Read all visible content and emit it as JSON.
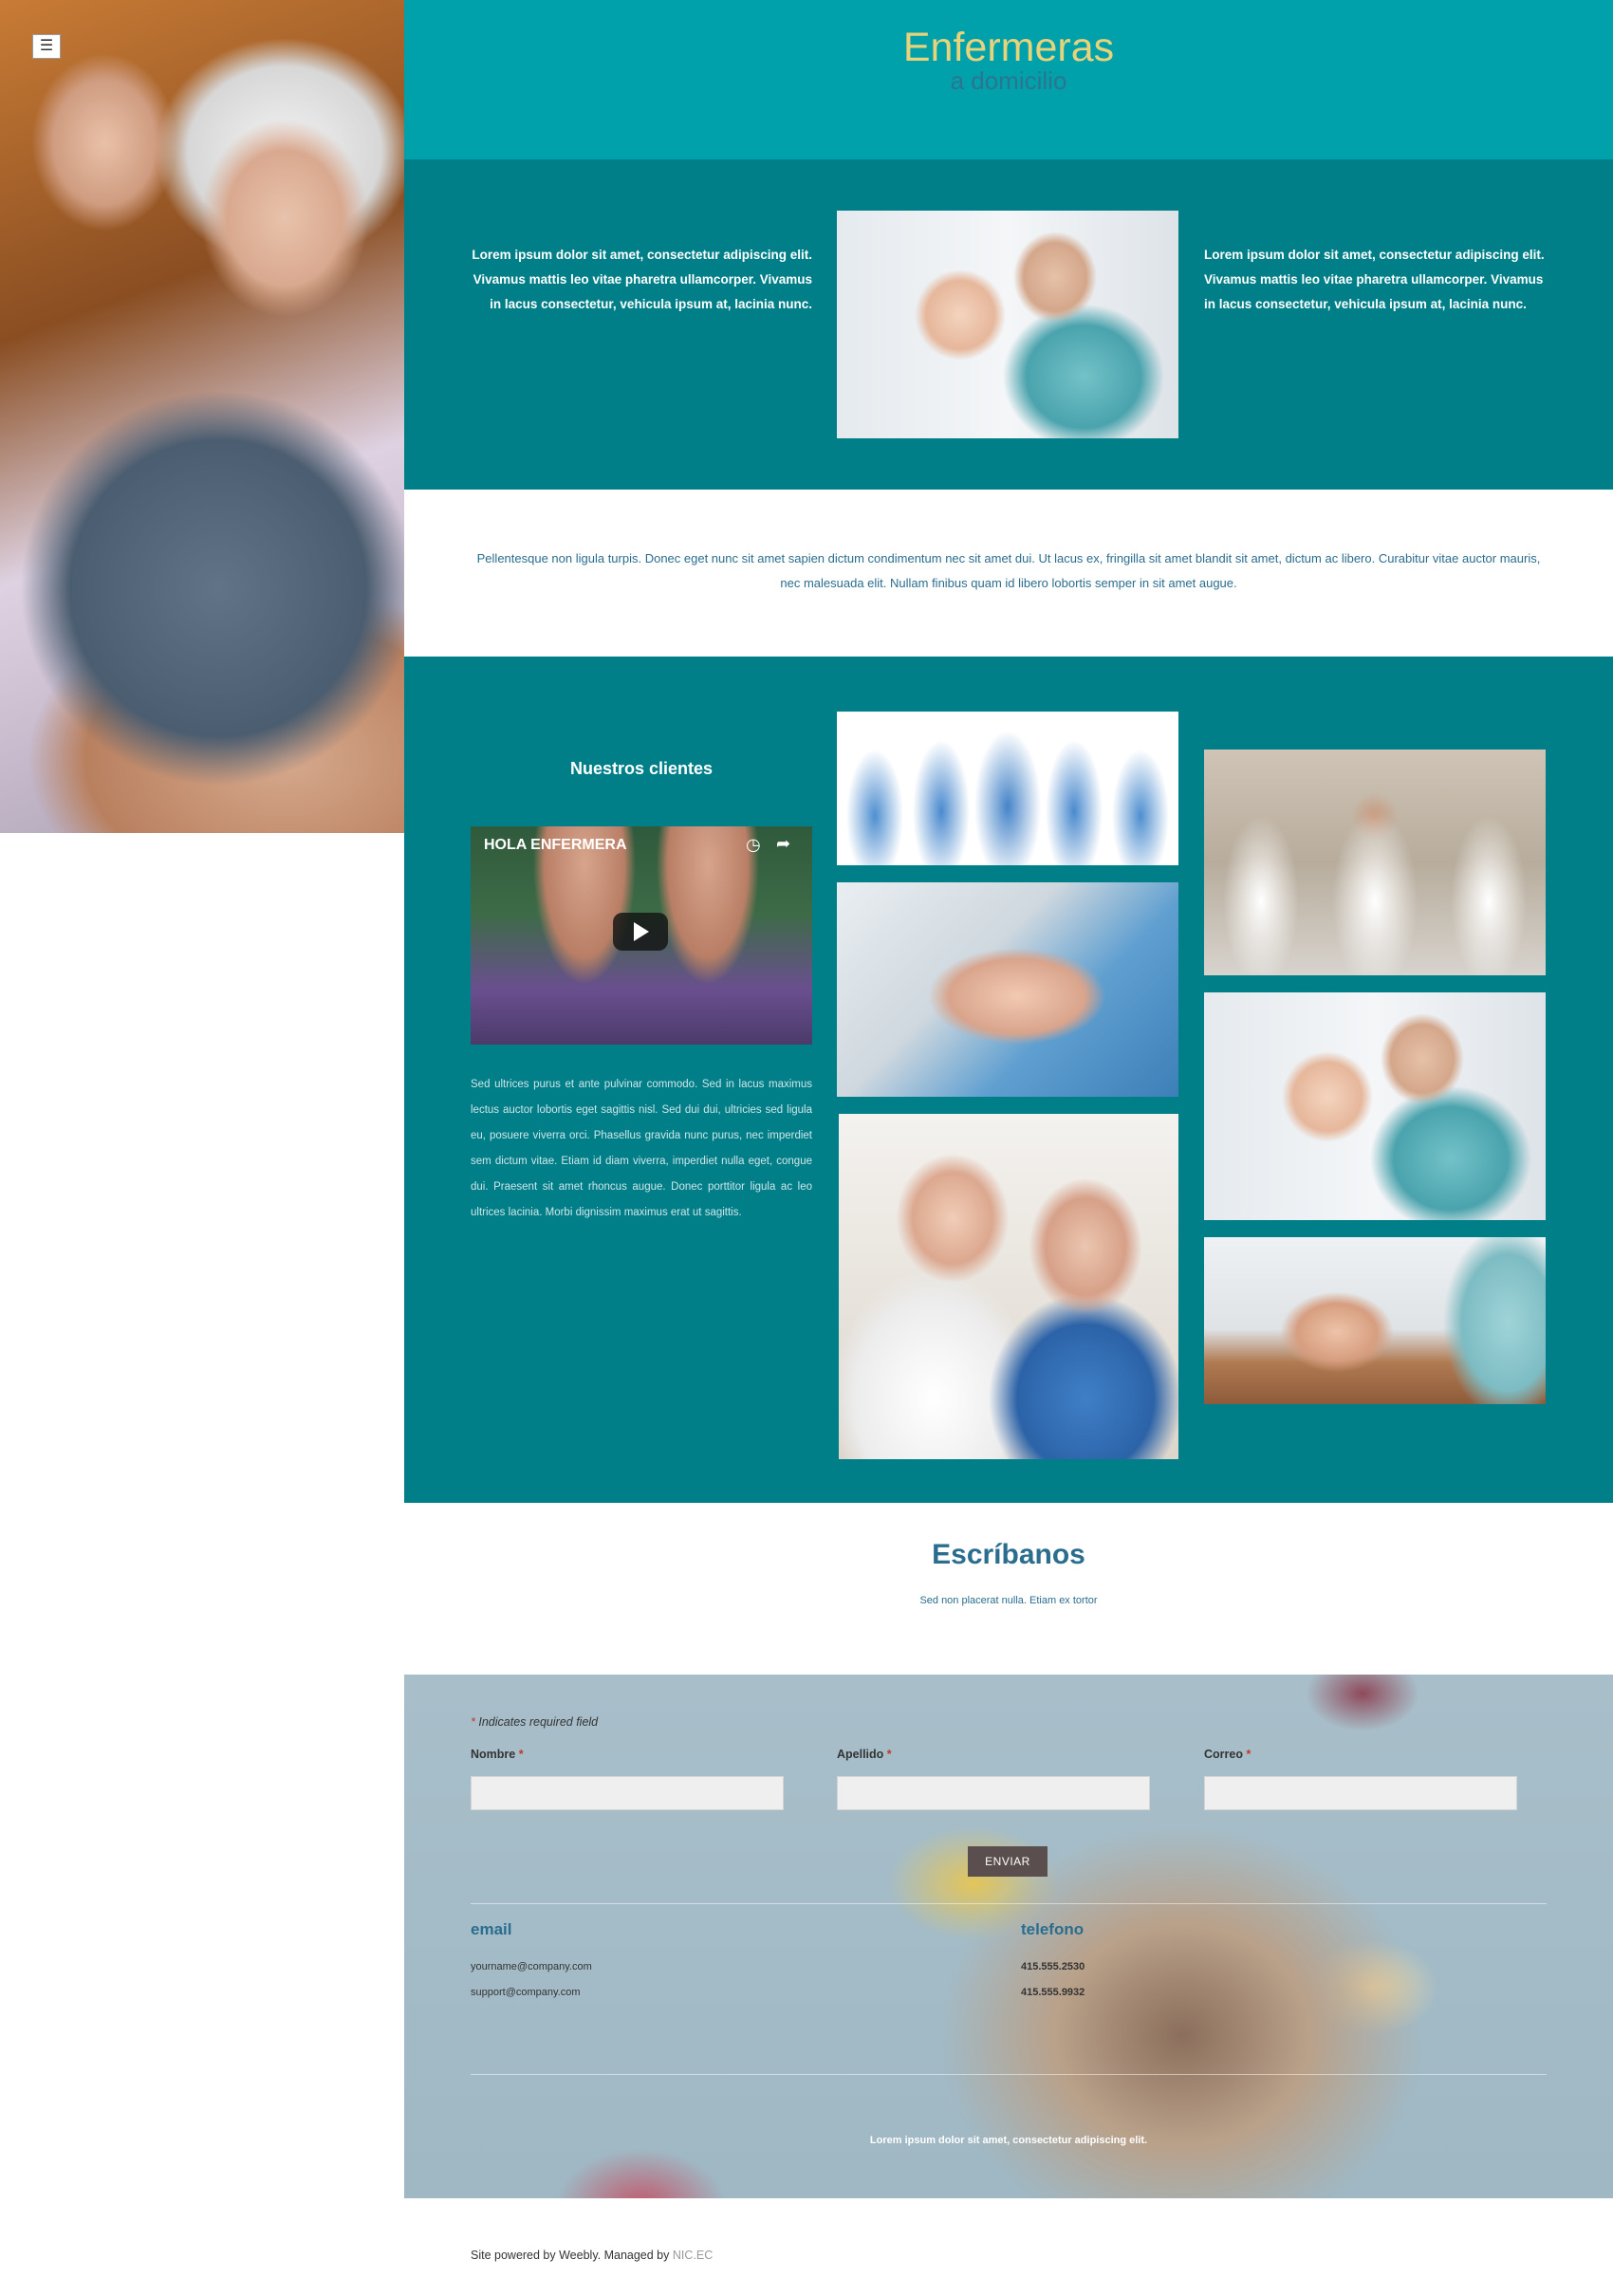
{
  "header": {
    "title": "Enfermeras",
    "subtitle": "a domicilio"
  },
  "intro": {
    "left_text": "Lorem ipsum dolor sit amet, consectetur adipiscing elit. Vivamus mattis leo vitae pharetra ullamcorper. Vivamus in lacus consectetur, vehicula ipsum at, lacinia nunc.",
    "right_text": "Lorem ipsum dolor sit amet, consectetur adipiscing elit. Vivamus mattis leo vitae pharetra ullamcorper. Vivamus in lacus consectetur, vehicula ipsum at, lacinia nunc."
  },
  "paragraph": {
    "text": "Pellentesque non ligula turpis. Donec eget nunc sit amet sapien dictum condimentum nec sit amet dui. Ut lacus ex, fringilla sit amet blandit sit amet, dictum ac libero. Curabitur vitae auctor mauris, nec malesuada elit. Nullam finibus quam id libero lobortis semper in sit amet augue."
  },
  "clients": {
    "title": "Nuestros clientes",
    "video_title": "HOLA ENFERMERA",
    "text": "Sed ultrices purus et ante pulvinar commodo. Sed in lacus maximus lectus auctor lobortis eget sagittis nisl. Sed dui dui, ultricies sed ligula eu, posuere viverra orci. Phasellus gravida nunc purus, nec imperdiet sem dictum vitae. Etiam id diam viverra, imperdiet nulla eget, congue dui. Praesent sit amet rhoncus augue. Donec porttitor ligula ac leo ultrices lacinia. Morbi dignissim maximus erat ut sagittis."
  },
  "contact": {
    "title": "Escríbanos",
    "subtitle": "Sed non placerat nulla. Etiam ex tortor",
    "required_note": "Indicates required field",
    "required_marker": "*",
    "fields": {
      "nombre": "Nombre",
      "apellido": "Apellido",
      "correo": "Correo"
    },
    "submit_label": "ENVIAR",
    "email_heading": "email",
    "emails": [
      "yourname@company.com",
      "support@company.com"
    ],
    "phone_heading": "telefono",
    "phones": [
      "415.555.2530",
      "415.555.9932"
    ],
    "footer_note": "Lorem ipsum dolor sit amet, consectetur adipiscing elit."
  },
  "footer": {
    "powered_text": "Site powered by Weebly. Managed by",
    "powered_link": "NIC.EC"
  },
  "icons": {
    "menu": "hamburger-menu-icon",
    "video_clock": "clock-icon",
    "video_share": "share-icon",
    "video_play": "play-icon"
  },
  "colors": {
    "header_teal": "#00a1ab",
    "band_teal": "#007f88",
    "title_gold": "#e8d27a",
    "heading_blue": "#2b6d8e",
    "button_dark": "#5a4e4e"
  }
}
